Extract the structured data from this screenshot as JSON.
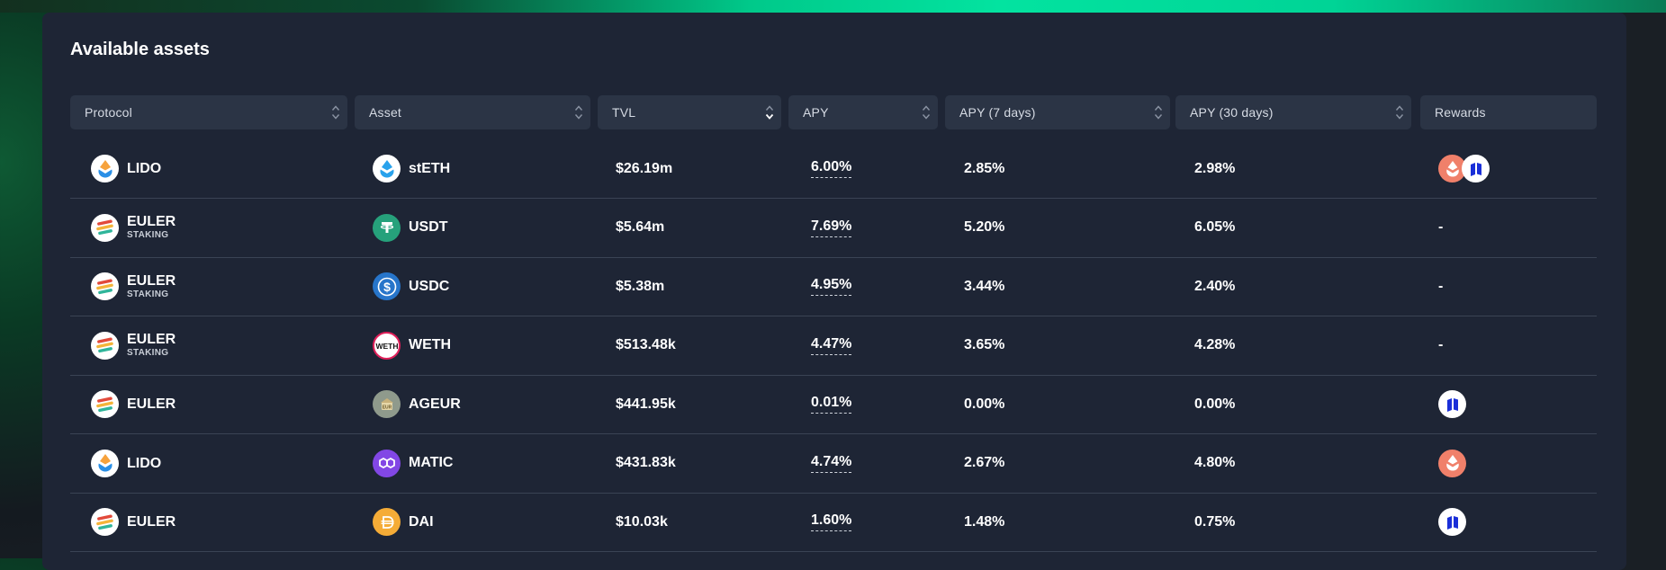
{
  "title": "Available assets",
  "columns": [
    "Protocol",
    "Asset",
    "TVL",
    "APY",
    "APY (7 days)",
    "APY (30 days)",
    "Rewards"
  ],
  "active_sort_column": "TVL",
  "active_sort_direction": "descending",
  "rows": [
    {
      "protocol": "LIDO",
      "protocol_sub": "",
      "protocol_icon": "lido-icon",
      "asset": "stETH",
      "asset_icon": "steth-icon",
      "tvl": "$26.19m",
      "apy": "6.00%",
      "apy7": "2.85%",
      "apy30": "2.98%",
      "rewards": [
        "lido-reward-icon",
        "euler-reward-icon"
      ],
      "rewards_text": ""
    },
    {
      "protocol": "EULER",
      "protocol_sub": "STAKING",
      "protocol_icon": "euler-icon",
      "asset": "USDT",
      "asset_icon": "usdt-icon",
      "tvl": "$5.64m",
      "apy": "7.69%",
      "apy7": "5.20%",
      "apy30": "6.05%",
      "rewards": [],
      "rewards_text": "-"
    },
    {
      "protocol": "EULER",
      "protocol_sub": "STAKING",
      "protocol_icon": "euler-icon",
      "asset": "USDC",
      "asset_icon": "usdc-icon",
      "tvl": "$5.38m",
      "apy": "4.95%",
      "apy7": "3.44%",
      "apy30": "2.40%",
      "rewards": [],
      "rewards_text": "-"
    },
    {
      "protocol": "EULER",
      "protocol_sub": "STAKING",
      "protocol_icon": "euler-icon",
      "asset": "WETH",
      "asset_icon": "weth-icon",
      "tvl": "$513.48k",
      "apy": "4.47%",
      "apy7": "3.65%",
      "apy30": "4.28%",
      "rewards": [],
      "rewards_text": "-"
    },
    {
      "protocol": "EULER",
      "protocol_sub": "",
      "protocol_icon": "euler-icon",
      "asset": "AGEUR",
      "asset_icon": "ageur-icon",
      "tvl": "$441.95k",
      "apy": "0.01%",
      "apy7": "0.00%",
      "apy30": "0.00%",
      "rewards": [
        "euler-reward-icon"
      ],
      "rewards_text": ""
    },
    {
      "protocol": "LIDO",
      "protocol_sub": "",
      "protocol_icon": "lido-icon",
      "asset": "MATIC",
      "asset_icon": "matic-icon",
      "tvl": "$431.83k",
      "apy": "4.74%",
      "apy7": "2.67%",
      "apy30": "4.80%",
      "rewards": [
        "lido-reward-icon"
      ],
      "rewards_text": ""
    },
    {
      "protocol": "EULER",
      "protocol_sub": "",
      "protocol_icon": "euler-icon",
      "asset": "DAI",
      "asset_icon": "dai-icon",
      "tvl": "$10.03k",
      "apy": "1.60%",
      "apy7": "1.48%",
      "apy30": "0.75%",
      "rewards": [
        "euler-reward-icon"
      ],
      "rewards_text": ""
    }
  ],
  "colors": {
    "background": "#1a1f25",
    "panel": "#1e2535",
    "header_cell": "#2b3445",
    "divider": "#3a4354",
    "accent_green": "#03e3a0",
    "lido_reward": "#f0806a",
    "euler_reward_blue": "#1a2fd8"
  }
}
